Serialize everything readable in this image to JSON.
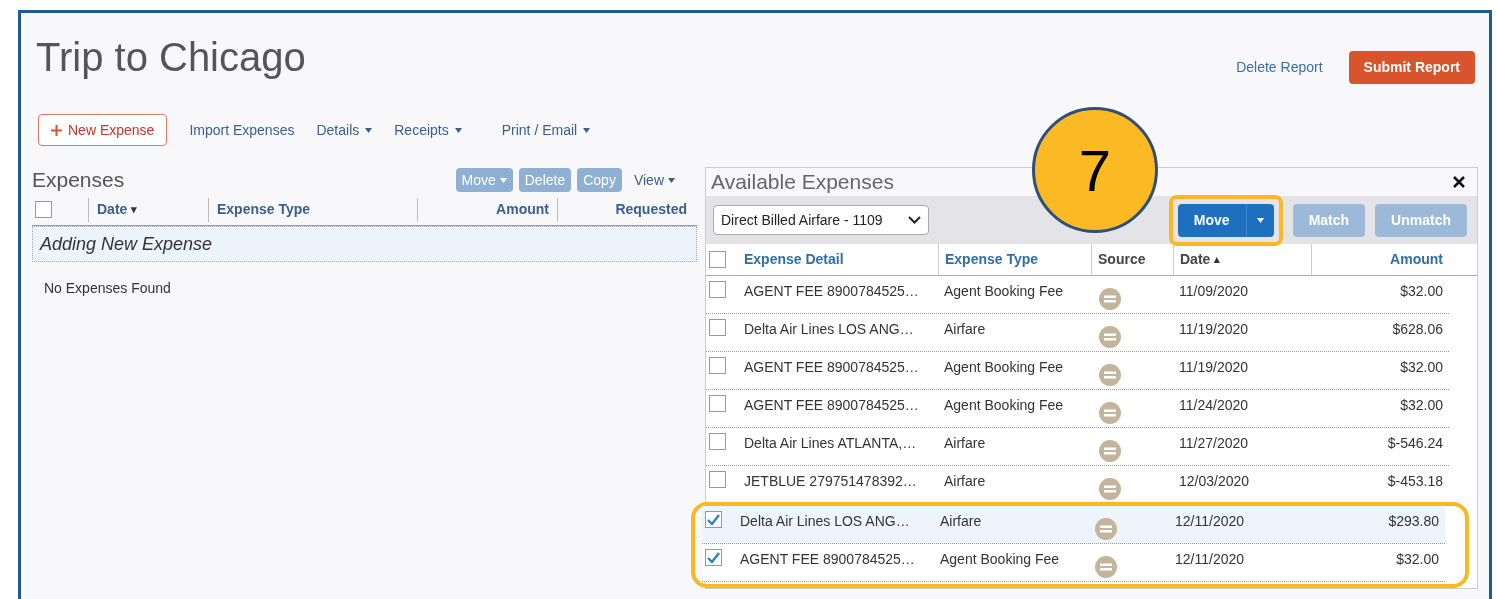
{
  "report": {
    "title": "Trip to Chicago",
    "delete_link": "Delete Report",
    "submit_button": "Submit Report"
  },
  "toolbar": [
    {
      "label": "New Expense",
      "kind": "primary",
      "menu": false
    },
    {
      "label": "Import Expenses",
      "kind": "link",
      "menu": false
    },
    {
      "label": "Details",
      "kind": "link",
      "menu": true
    },
    {
      "label": "Receipts",
      "kind": "link",
      "menu": true
    },
    {
      "label": "Print / Email",
      "kind": "link",
      "menu": true
    }
  ],
  "expenses": {
    "title": "Expenses",
    "actions": [
      {
        "label": "Move",
        "menu": true,
        "disabled": true
      },
      {
        "label": "Delete",
        "menu": false,
        "disabled": true
      },
      {
        "label": "Copy",
        "menu": false,
        "disabled": true
      },
      {
        "label": "View",
        "menu": true,
        "disabled": false
      }
    ],
    "all_checked": false,
    "columns": [
      {
        "label": "Date",
        "sort_mark": "▾"
      },
      {
        "label": "Expense Type"
      },
      {
        "label": "Amount"
      },
      {
        "label": "Requested"
      }
    ],
    "new_row": "Adding New Expense",
    "empty": "No Expenses Found"
  },
  "available": {
    "title": "Available Expenses",
    "filter": "Direct Billed Airfare - 1109",
    "buttons": [
      {
        "label": "Move",
        "menu": true,
        "disabled": false,
        "highlighted": true
      },
      {
        "label": "Match",
        "menu": false,
        "disabled": true,
        "highlighted": false
      },
      {
        "label": "Unmatch",
        "menu": false,
        "disabled": true,
        "highlighted": false
      }
    ],
    "all_checked": false,
    "columns": [
      {
        "label": "Expense Detail"
      },
      {
        "label": "Expense Type"
      },
      {
        "label": "Source"
      },
      {
        "label": "Date",
        "sort_mark": "▴"
      },
      {
        "label": "Amount"
      }
    ],
    "rows": [
      {
        "detail": "AGENT FEE 8900784525…",
        "type": "Agent Booking Fee",
        "date": "11/09/2020",
        "amount": "$32.00",
        "checked": false,
        "selected": false,
        "highlighted": false
      },
      {
        "detail": "Delta Air Lines LOS ANG…",
        "type": "Airfare",
        "date": "11/19/2020",
        "amount": "$628.06",
        "checked": false,
        "selected": false,
        "highlighted": false
      },
      {
        "detail": "AGENT FEE 8900784525…",
        "type": "Agent Booking Fee",
        "date": "11/19/2020",
        "amount": "$32.00",
        "checked": false,
        "selected": false,
        "highlighted": false
      },
      {
        "detail": "AGENT FEE 8900784525…",
        "type": "Agent Booking Fee",
        "date": "11/24/2020",
        "amount": "$32.00",
        "checked": false,
        "selected": false,
        "highlighted": false
      },
      {
        "detail": "Delta Air Lines ATLANTA,…",
        "type": "Airfare",
        "date": "11/27/2020",
        "amount": "$-546.24",
        "checked": false,
        "selected": false,
        "highlighted": false
      },
      {
        "detail": "JETBLUE 279751478392…",
        "type": "Airfare",
        "date": "12/03/2020",
        "amount": "$-453.18",
        "checked": false,
        "selected": false,
        "highlighted": false
      },
      {
        "detail": "Delta Air Lines LOS ANG…",
        "type": "Airfare",
        "date": "12/11/2020",
        "amount": "$293.80",
        "checked": true,
        "selected": true,
        "highlighted": true
      },
      {
        "detail": "AGENT FEE 8900784525…",
        "type": "Agent Booking Fee",
        "date": "12/11/2020",
        "amount": "$32.00",
        "checked": true,
        "selected": false,
        "highlighted": true
      }
    ]
  },
  "callout": {
    "label": "7"
  }
}
